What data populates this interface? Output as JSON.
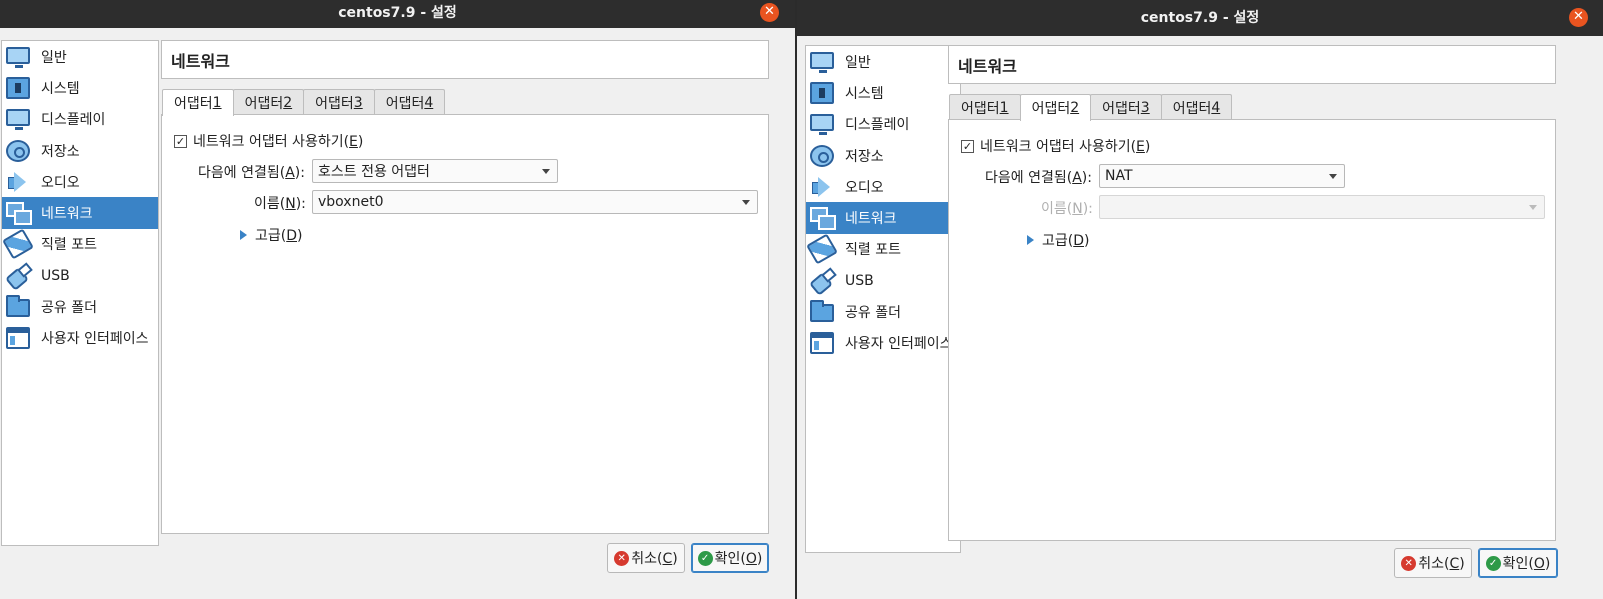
{
  "windows": [
    {
      "title": "centos7.9 - 설정",
      "close_symbol": "✕",
      "sidebar": [
        {
          "label": "일반",
          "icon": "monitor-icon"
        },
        {
          "label": "시스템",
          "icon": "chip-icon"
        },
        {
          "label": "디스플레이",
          "icon": "display-icon"
        },
        {
          "label": "저장소",
          "icon": "storage-icon"
        },
        {
          "label": "오디오",
          "icon": "speaker-icon"
        },
        {
          "label": "네트워크",
          "icon": "network-icon",
          "active": true
        },
        {
          "label": "직렬 포트",
          "icon": "serial-port-icon"
        },
        {
          "label": "USB",
          "icon": "usb-icon"
        },
        {
          "label": "공유 폴더",
          "icon": "folder-icon"
        },
        {
          "label": "사용자 인터페이스",
          "icon": "ui-window-icon"
        }
      ],
      "section_title": "네트워크",
      "tabs": [
        {
          "prefix": "어댑터 ",
          "num": "1",
          "active": true
        },
        {
          "prefix": "어댑터 ",
          "num": "2"
        },
        {
          "prefix": "어댑터 ",
          "num": "3"
        },
        {
          "prefix": "어댑터 ",
          "num": "4"
        }
      ],
      "enable_checkbox": {
        "label_pre": "네트워크 어댑터 사용하기(",
        "mnemonic": "E",
        "label_post": ")",
        "checked": true,
        "check_symbol": "✓"
      },
      "attached_label_pre": "다음에 연결됨(",
      "attached_mnemonic": "A",
      "attached_label_post": "):",
      "attached_value": "호스트 전용 어댑터",
      "name_label_pre": "이름(",
      "name_mnemonic": "N",
      "name_label_post": "):",
      "name_value": "vboxnet0",
      "name_disabled": false,
      "advanced_pre": "고급(",
      "advanced_mnemonic": "D",
      "advanced_post": ")",
      "cancel_label": "취소(",
      "cancel_mnemonic": "C",
      "cancel_post": ")",
      "ok_label": "확인(",
      "ok_mnemonic": "O",
      "ok_post": ")",
      "cancel_icon": "✕",
      "ok_icon": "✓"
    },
    {
      "title": "centos7.9 - 설정",
      "close_symbol": "✕",
      "sidebar": [
        {
          "label": "일반",
          "icon": "monitor-icon"
        },
        {
          "label": "시스템",
          "icon": "chip-icon"
        },
        {
          "label": "디스플레이",
          "icon": "display-icon"
        },
        {
          "label": "저장소",
          "icon": "storage-icon"
        },
        {
          "label": "오디오",
          "icon": "speaker-icon"
        },
        {
          "label": "네트워크",
          "icon": "network-icon",
          "active": true
        },
        {
          "label": "직렬 포트",
          "icon": "serial-port-icon"
        },
        {
          "label": "USB",
          "icon": "usb-icon"
        },
        {
          "label": "공유 폴더",
          "icon": "folder-icon"
        },
        {
          "label": "사용자 인터페이스",
          "icon": "ui-window-icon"
        }
      ],
      "section_title": "네트워크",
      "tabs": [
        {
          "prefix": "어댑터 ",
          "num": "1"
        },
        {
          "prefix": "어댑터 ",
          "num": "2",
          "active": true
        },
        {
          "prefix": "어댑터 ",
          "num": "3"
        },
        {
          "prefix": "어댑터 ",
          "num": "4"
        }
      ],
      "enable_checkbox": {
        "label_pre": "네트워크 어댑터 사용하기(",
        "mnemonic": "E",
        "label_post": ")",
        "checked": true,
        "check_symbol": "✓"
      },
      "attached_label_pre": "다음에 연결됨(",
      "attached_mnemonic": "A",
      "attached_label_post": "):",
      "attached_value": "NAT",
      "name_label_pre": "이름(",
      "name_mnemonic": "N",
      "name_label_post": "):",
      "name_value": "",
      "name_disabled": true,
      "advanced_pre": "고급(",
      "advanced_mnemonic": "D",
      "advanced_post": ")",
      "cancel_label": "취소(",
      "cancel_mnemonic": "C",
      "cancel_post": ")",
      "ok_label": "확인(",
      "ok_mnemonic": "O",
      "ok_post": ")",
      "cancel_icon": "✕",
      "ok_icon": "✓"
    }
  ],
  "colors": {
    "accent": "#3a83c6",
    "close": "#e95420",
    "cancel": "#d63a2f",
    "ok": "#2e9a48"
  }
}
